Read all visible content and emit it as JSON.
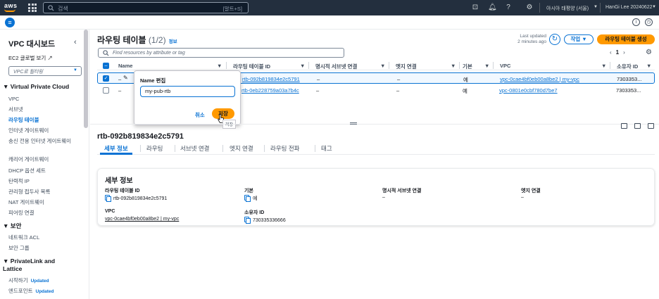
{
  "topnav": {
    "logo": "aws",
    "search_placeholder": "검색",
    "search_shortcut": "[알트+S]",
    "region": "아시아 태평양 (서울)",
    "user": "HanGi Lee 20240622"
  },
  "sidebar": {
    "title": "VPC 대시보드",
    "ec2_link": "EC2 글로벌 보기",
    "filter_placeholder": "VPC로 필터링",
    "section_vpc": "Virtual Private Cloud",
    "vpc_items": [
      "VPC",
      "서브넷",
      "라우팅 테이블",
      "인터넷 게이트웨이",
      "송신 전용 인터넷 게이트웨이",
      "캐리어 게이트웨이",
      "DHCP 옵션 세트",
      "탄력적 IP",
      "관리형 접두사 목록",
      "NAT 게이트웨이",
      "피어링 연결"
    ],
    "section_security": "보안",
    "security_items": [
      "네트워크 ACL",
      "보안 그룹"
    ],
    "section_privatelink": "PrivateLink and Lattice",
    "privatelink_items": [
      {
        "label": "시작하기",
        "badge": "Updated"
      },
      {
        "label": "엔드포인트",
        "badge": "Updated"
      }
    ]
  },
  "main": {
    "title": "라우팅 테이블",
    "count": "(1/2)",
    "info": "정보",
    "last_updated_line1": "Last updated",
    "last_updated_line2": "2 minutes ago",
    "actions_label": "작업 ▼",
    "create_label": "라우팅 테이블 생성",
    "filter_placeholder": "Find resources by attribute or tag",
    "page": "1",
    "columns": [
      "Name",
      "라우팅 테이블 ID",
      "명시적 서브넷 연결",
      "엣지 연결",
      "기본",
      "VPC",
      "소유자 ID"
    ],
    "rows": [
      {
        "name": "–",
        "id": "rtb-092b819834e2c5791",
        "subnet": "–",
        "edge": "–",
        "main": "예",
        "vpc": "vpc-0cae4bf0eb00a8be2 | my-vpc",
        "owner": "7303353..."
      },
      {
        "name": "–",
        "id": "rtb-0eb228759a03a7b4c",
        "subnet": "–",
        "edge": "–",
        "main": "예",
        "vpc": "vpc-0801e0cbf780d7be7",
        "owner": "7303353..."
      }
    ]
  },
  "popover": {
    "title": "Name 편집",
    "value": "my-pub-rtb",
    "cancel": "취소",
    "save": "저장",
    "tooltip": "저장"
  },
  "detail": {
    "title": "rtb-092b819834e2c5791",
    "tabs": [
      "세부 정보",
      "라우팅",
      "서브넷 연결",
      "엣지 연결",
      "라우팅 전파",
      "태그"
    ],
    "card_title": "세부 정보",
    "fields": {
      "rtb_label": "라우팅 테이블 ID",
      "rtb_value": "rtb-092b819834e2c5791",
      "main_label": "기본",
      "main_value": "예",
      "subnet_label": "명시적 서브넷 연결",
      "subnet_value": "–",
      "edge_label": "엣지 연결",
      "edge_value": "–",
      "vpc_label": "VPC",
      "vpc_value": "vpc-0cae4bf0eb00a8be2 | my-vpc",
      "owner_label": "소유자 ID",
      "owner_value": "730335336666"
    }
  },
  "colors": {
    "nav": "#232f3e",
    "accent": "#0972d3",
    "primary_button": "#ff9900"
  }
}
